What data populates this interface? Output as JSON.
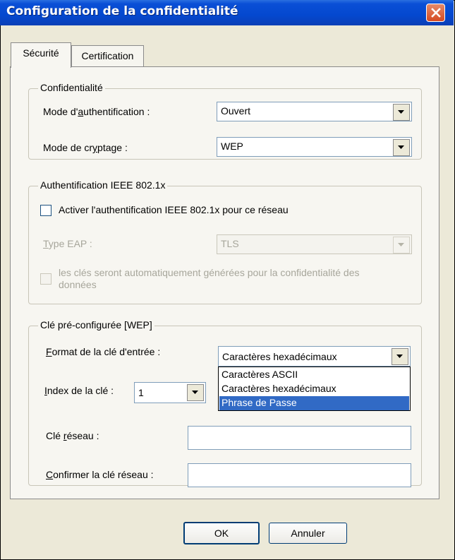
{
  "window": {
    "title": "Configuration de la confidentialité"
  },
  "tabs": [
    {
      "label": "Sécurité",
      "active": true
    },
    {
      "label": "Certification",
      "active": false
    }
  ],
  "privacy": {
    "legend": "Confidentialité",
    "auth_mode_label": "Mode d'authentification :",
    "auth_mode_value": "Ouvert",
    "encryption_label": "Mode de cryptage :",
    "encryption_value": "WEP"
  },
  "ieee": {
    "legend": "Authentification IEEE 802.1x",
    "enable_label": "Activer l'authentification IEEE 802.1x pour ce réseau",
    "eap_type_label": "Type EAP :",
    "eap_type_value": "TLS",
    "auto_keys_label_line1": "les clés seront automatiquement générées pour la confidentialité des",
    "auto_keys_label_line2": "données"
  },
  "wep": {
    "legend": "Clé pré-configurée [WEP]",
    "key_format_label": "Format de la clé d'entrée :",
    "key_format_value": "Caractères hexadécimaux",
    "key_format_options": [
      "Caractères ASCII",
      "Caractères hexadécimaux",
      "Phrase de Passe"
    ],
    "key_format_highlighted": "Phrase de Passe",
    "key_index_label": "Index de la clé :",
    "key_index_value": "1",
    "network_key_label": "Clé réseau :",
    "network_key_value": "",
    "confirm_key_label": "Confirmer la clé réseau :",
    "confirm_key_value": ""
  },
  "buttons": {
    "ok": "OK",
    "cancel": "Annuler"
  },
  "colors": {
    "titlebar": "#0448cf",
    "selection": "#316ac5",
    "face": "#ece9d8"
  }
}
